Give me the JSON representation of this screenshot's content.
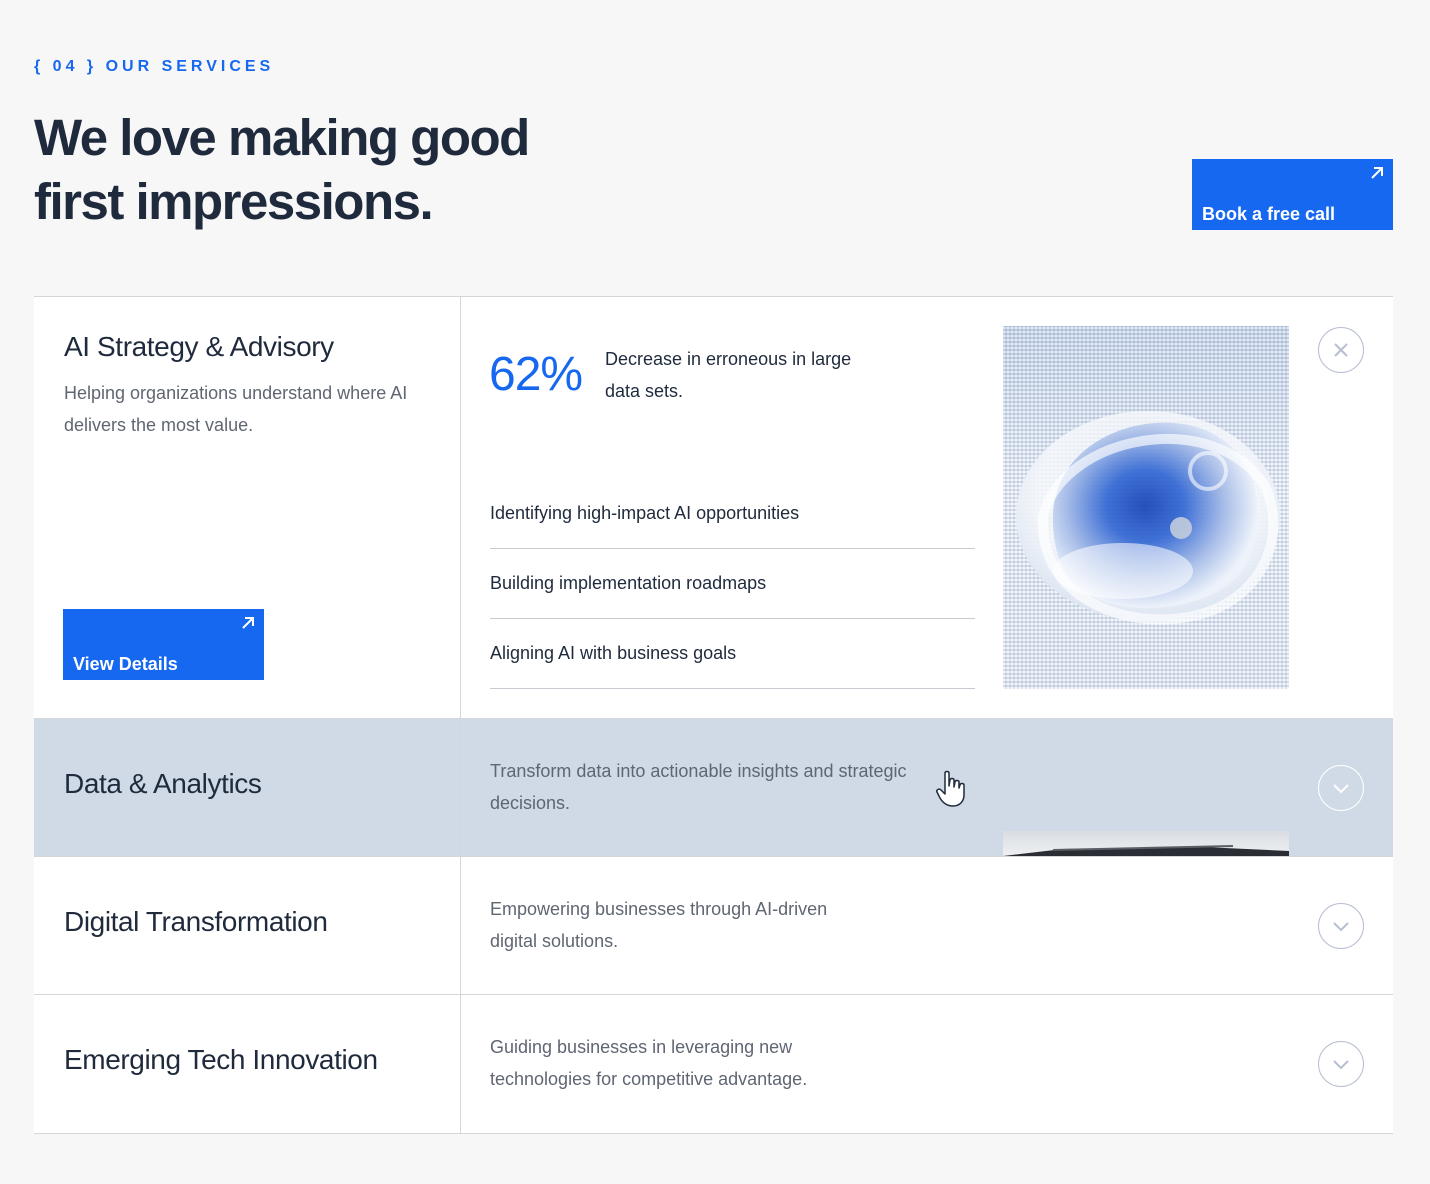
{
  "section": {
    "eyebrow": "{ 04 } OUR SERVICES",
    "headline": "We love making good first impressions.",
    "cta_label": "Book a free call"
  },
  "services": [
    {
      "title": "AI Strategy & Advisory",
      "description": "Helping organizations understand where AI delivers the most value.",
      "button_label": "View Details",
      "stat_value": "62%",
      "stat_text": "Decrease in erroneous in large data sets.",
      "items": [
        "Identifying high-impact AI opportunities",
        "Building implementation roadmaps",
        "Aligning AI with business goals"
      ]
    },
    {
      "title": "Data & Analytics",
      "description": "Transform data into actionable insights and strategic decisions."
    },
    {
      "title": "Digital Transformation",
      "description": "Empowering businesses through AI-driven digital solutions."
    },
    {
      "title": "Emerging Tech Innovation",
      "description": "Guiding businesses in leveraging new technologies for competitive advantage."
    }
  ],
  "colors": {
    "accent": "#1668f0",
    "hover_row": "#cfdae6",
    "heading": "#1f2a3c",
    "muted_text": "#5f6672",
    "background": "#f7f7f8"
  },
  "icons": {
    "cta_arrow": "arrow-up-right-icon",
    "collapse": "close-icon",
    "expand": "chevron-down-icon",
    "cursor": "hand-pointer-icon"
  }
}
